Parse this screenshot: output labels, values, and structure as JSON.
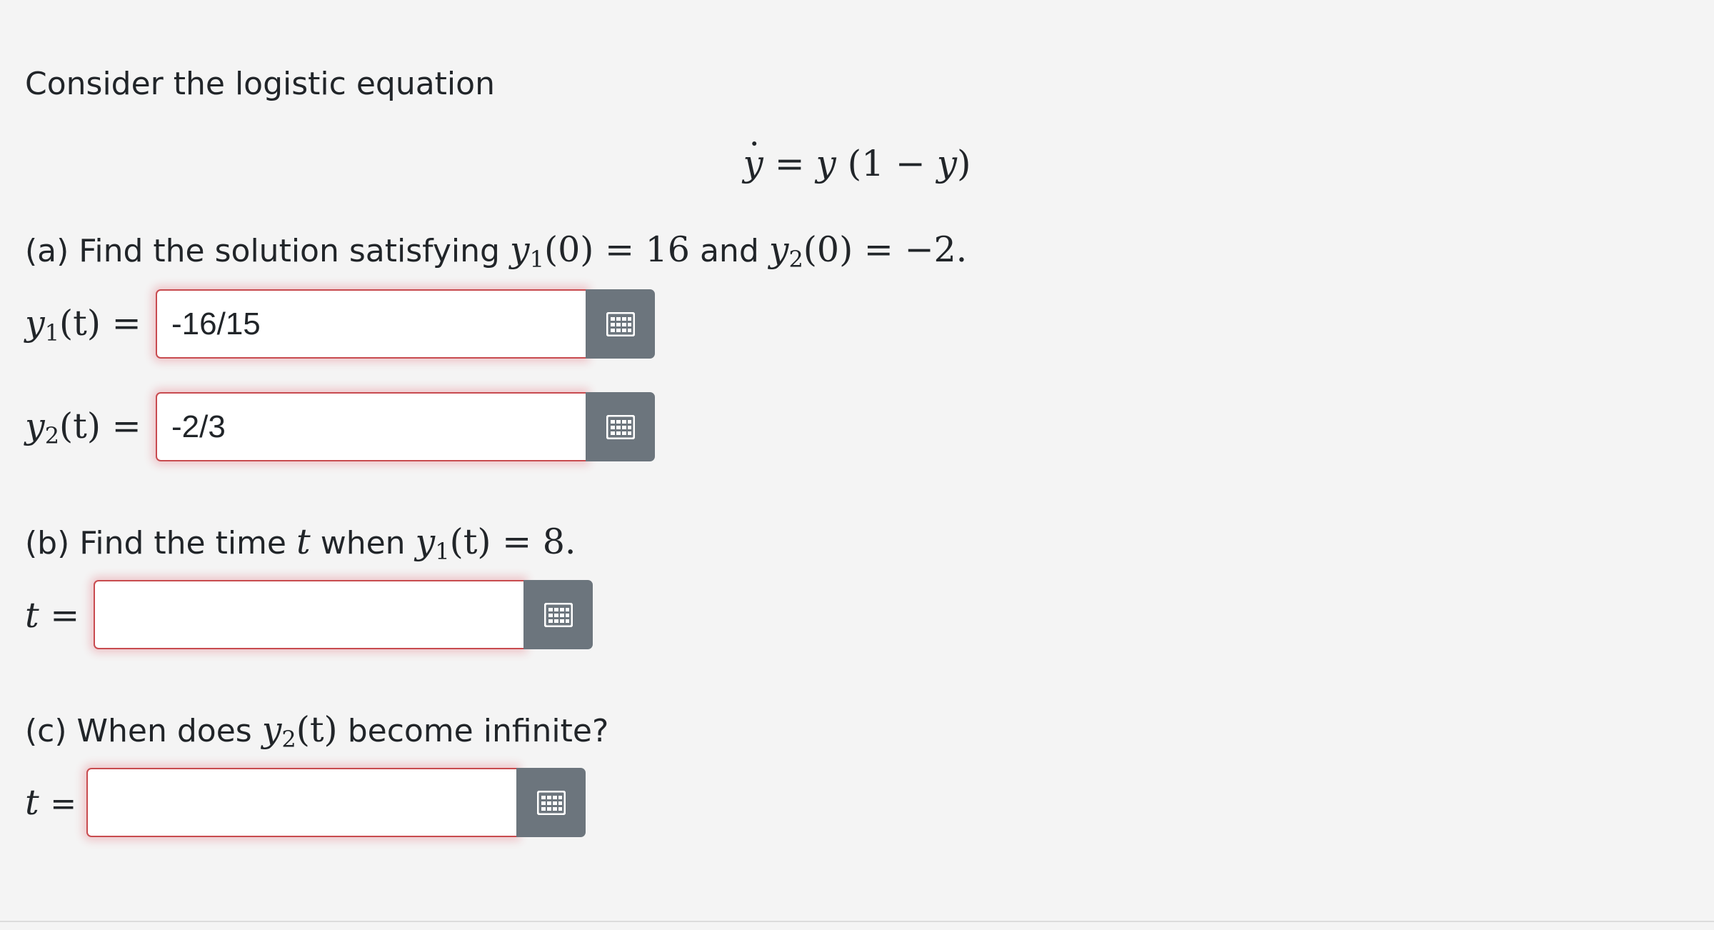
{
  "intro": {
    "text": "Consider the logistic equation"
  },
  "equation": {
    "dot_var": "y",
    "equals": "=",
    "rhs_var": "y",
    "open_paren": "(",
    "one": "1",
    "minus": "−",
    "inner_var": "y",
    "close_paren": ")"
  },
  "part_a": {
    "prefix": "(a) Find the solution satisfying",
    "cond1": {
      "var": "y",
      "sub": "1",
      "arg": "(0)",
      "rel": "=",
      "value": "16"
    },
    "and": "and",
    "cond2": {
      "var": "y",
      "sub": "2",
      "arg": "(0)",
      "rel": "=",
      "value": "−2."
    },
    "answer1": {
      "label_var": "y",
      "label_sub": "1",
      "label_arg": "(t)",
      "label_eq": "=",
      "value": "-16/15"
    },
    "answer2": {
      "label_var": "y",
      "label_sub": "2",
      "label_arg": "(t)",
      "label_eq": "=",
      "value": "-2/3"
    }
  },
  "part_b": {
    "prefix": "(b) Find the time",
    "t": "t",
    "when": "when",
    "cond": {
      "var": "y",
      "sub": "1",
      "arg": "(t)",
      "rel": "=",
      "value": "8."
    },
    "answer": {
      "label_var": "t",
      "label_eq": "=",
      "value": ""
    }
  },
  "part_c": {
    "prefix": "(c) When does",
    "cond": {
      "var": "y",
      "sub": "2",
      "arg": "(t)"
    },
    "suffix": "become infinite?",
    "answer": {
      "label_var": "t",
      "label_eq": "=",
      "value": ""
    }
  },
  "icons": {
    "palette": "keypad-grid-icon"
  },
  "colors": {
    "background": "#f4f4f4",
    "palette_button": "#6c757d",
    "input_border": "#c84b4f",
    "text": "#212529"
  }
}
